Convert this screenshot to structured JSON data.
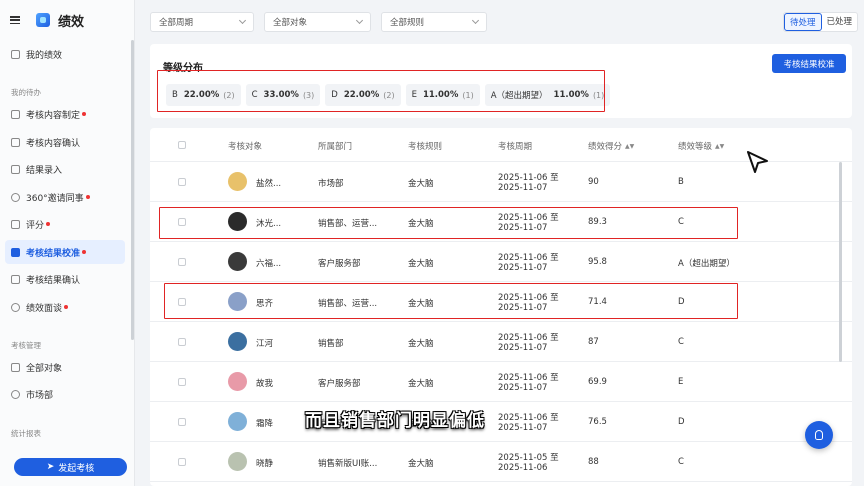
{
  "app": {
    "title": "绩效"
  },
  "sidebar": {
    "my": "我的绩效",
    "todo_section": "我的待办",
    "todo_items": [
      {
        "label": "考核内容制定",
        "badge": true
      },
      {
        "label": "考核内容确认",
        "badge": false
      },
      {
        "label": "结果录入",
        "badge": false
      },
      {
        "label": "360°邀请同事",
        "badge": true
      },
      {
        "label": "评分",
        "badge": true
      },
      {
        "label": "考核结果校准",
        "badge": true,
        "active": true
      },
      {
        "label": "考核结果确认",
        "badge": false
      },
      {
        "label": "绩效面谈",
        "badge": true
      }
    ],
    "mgmt_section": "考核管理",
    "mgmt_items": [
      {
        "label": "全部对象"
      },
      {
        "label": "市场部"
      }
    ],
    "stats_section": "统计报表",
    "launch_button": "发起考核"
  },
  "filters": {
    "period": "全部周期",
    "object": "全部对象",
    "rule": "全部规则"
  },
  "status_toggle": {
    "pending": "待处理",
    "done": "已处理"
  },
  "distribution": {
    "title": "等级分布",
    "calibrate_button": "考核结果校准",
    "chips": [
      {
        "grade": "B",
        "pct": "22.00%",
        "count": "(2)"
      },
      {
        "grade": "C",
        "pct": "33.00%",
        "count": "(3)"
      },
      {
        "grade": "D",
        "pct": "22.00%",
        "count": "(2)"
      },
      {
        "grade": "E",
        "pct": "11.00%",
        "count": "(1)"
      },
      {
        "grade": "A（超出期望）",
        "pct": "11.00%",
        "count": "(1)"
      }
    ]
  },
  "table": {
    "headers": {
      "object": "考核对象",
      "dept": "所属部门",
      "rule": "考核规则",
      "period": "考核周期",
      "score": "绩效得分",
      "grade": "绩效等级"
    },
    "rows": [
      {
        "name": "盐然...",
        "dept": "市场部",
        "rule": "金大脑",
        "period_start": "2025-11-06 至",
        "period_end": "2025-11-07",
        "score": "90",
        "grade": "B",
        "avatar_color": "#e8c16a"
      },
      {
        "name": "沐光...",
        "dept": "销售部、运营...",
        "rule": "金大脑",
        "period_start": "2025-11-06 至",
        "period_end": "2025-11-07",
        "score": "89.3",
        "grade": "C",
        "avatar_color": "#2b2b2b"
      },
      {
        "name": "六福...",
        "dept": "客户服务部",
        "rule": "金大脑",
        "period_start": "2025-11-06 至",
        "period_end": "2025-11-07",
        "score": "95.8",
        "grade": "A（超出期望）",
        "avatar_color": "#3a3a3a"
      },
      {
        "name": "思齐",
        "dept": "销售部、运营...",
        "rule": "金大脑",
        "period_start": "2025-11-06 至",
        "period_end": "2025-11-07",
        "score": "71.4",
        "grade": "D",
        "avatar_color": "#8aa0c8"
      },
      {
        "name": "江河",
        "dept": "销售部",
        "rule": "金大脑",
        "period_start": "2025-11-06 至",
        "period_end": "2025-11-07",
        "score": "87",
        "grade": "C",
        "avatar_color": "#3b6fa0"
      },
      {
        "name": "故我",
        "dept": "客户服务部",
        "rule": "金大脑",
        "period_start": "2025-11-06 至",
        "period_end": "2025-11-07",
        "score": "69.9",
        "grade": "E",
        "avatar_color": "#e89aa8"
      },
      {
        "name": "霜降",
        "dept": "销售部",
        "rule": "金大脑",
        "period_start": "2025-11-06 至",
        "period_end": "2025-11-07",
        "score": "76.5",
        "grade": "D",
        "avatar_color": "#7fb0d8"
      },
      {
        "name": "晓静",
        "dept": "销售新版UI账...",
        "rule": "金大脑",
        "period_start": "2025-11-05 至",
        "period_end": "2025-11-06",
        "score": "88",
        "grade": "C",
        "avatar_color": "#b9c2b0"
      }
    ]
  },
  "subtitle": "而且销售部门明显偏低"
}
